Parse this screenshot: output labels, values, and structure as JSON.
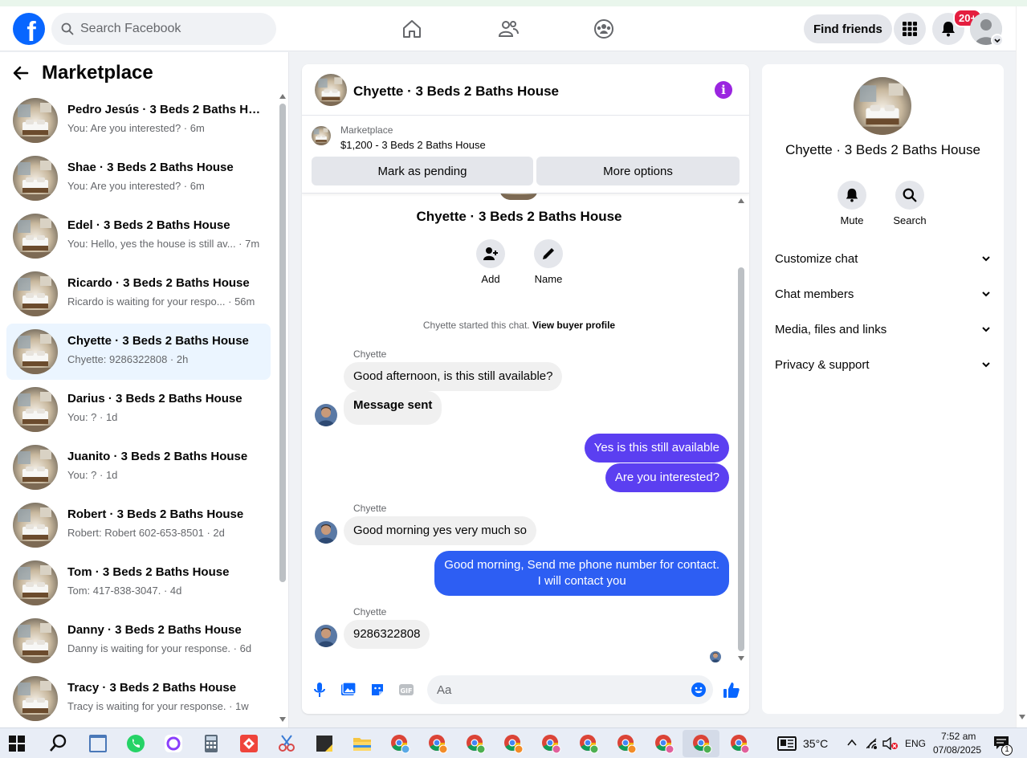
{
  "header": {
    "logo_letter": "f",
    "search_placeholder": "Search Facebook",
    "find_friends_label": "Find friends",
    "notification_badge": "20+"
  },
  "sidebar": {
    "title": "Marketplace",
    "conversations": [
      {
        "name": "Pedro Jesús · 3 Beds 2 Baths Ho...",
        "preview": "You: Are you interested? · 6m"
      },
      {
        "name": "Shae · 3 Beds 2 Baths House",
        "preview": "You: Are you interested? · 6m"
      },
      {
        "name": "Edel · 3 Beds 2 Baths House",
        "preview": "You: Hello, yes the house is still av...  · 7m"
      },
      {
        "name": "Ricardo · 3 Beds 2 Baths House",
        "preview": "Ricardo is waiting for your respo...  · 56m"
      },
      {
        "name": "Chyette · 3 Beds 2 Baths House",
        "preview": "Chyette: 9286322808 · 2h"
      },
      {
        "name": "Darius · 3 Beds 2 Baths House",
        "preview": "You: ? · 1d"
      },
      {
        "name": "Juanito · 3 Beds 2 Baths House",
        "preview": "You: ? · 1d"
      },
      {
        "name": "Robert · 3 Beds 2 Baths House",
        "preview": "Robert: Robert 602-653-8501 · 2d"
      },
      {
        "name": "Tom · 3 Beds 2 Baths House",
        "preview": "Tom: 417-838-3047. · 4d"
      },
      {
        "name": "Danny · 3 Beds 2 Baths House",
        "preview": "Danny is waiting for your response. · 6d"
      },
      {
        "name": "Tracy · 3 Beds 2 Baths House",
        "preview": "Tracy is waiting for your response. · 1w"
      }
    ]
  },
  "chat": {
    "title": "Chyette · 3 Beds 2 Baths House",
    "info_glyph": "i",
    "listing_source": "Marketplace",
    "listing_price": "$1,200 - 3 Beds 2 Baths House",
    "mark_pending_label": "Mark as pending",
    "more_options_label": "More options",
    "center_name": "Chyette · 3 Beds 2 Baths House",
    "add_label": "Add",
    "name_label": "Name",
    "started_text": "Chyette started this chat.",
    "buyer_profile_link": "View buyer profile",
    "messages": [
      {
        "sender": "Chyette",
        "text": "Good afternoon, is this still available?"
      },
      {
        "text": "Message sent"
      },
      {
        "text": "Yes is this still available"
      },
      {
        "text": "Are you interested?"
      },
      {
        "sender": "Chyette",
        "text": "Good morning yes very much so"
      },
      {
        "text_line1": "Good morning, Send me phone number for contact.",
        "text_line2": "I will contact you"
      },
      {
        "sender": "Chyette",
        "text": "9286322808"
      }
    ],
    "composer_placeholder": "Aa"
  },
  "info_panel": {
    "name": "Chyette · 3 Beds 2 Baths House",
    "mute_label": "Mute",
    "search_label": "Search",
    "sections": [
      "Customize chat",
      "Chat members",
      "Media, files and links",
      "Privacy & support"
    ]
  },
  "taskbar": {
    "temperature": "35°C",
    "language": "ENG",
    "time": "7:52 am",
    "date": "07/08/2025",
    "notification_count": "1"
  },
  "colors": {
    "brand": "#0866ff",
    "outgoing_purple": "#5b3ff1",
    "outgoing_blue": "#2d5ef3",
    "info_purple": "#9a25e0",
    "badge_red": "#e41e3f",
    "active_row": "#ebf5ff"
  }
}
